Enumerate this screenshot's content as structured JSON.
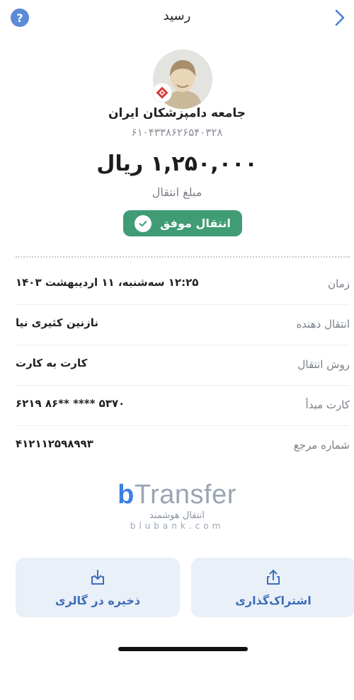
{
  "header": {
    "title": "رسید",
    "help_label": "?"
  },
  "recipient": {
    "name": "جامعه دامپزشکان ایران",
    "card_number": "۶۱۰۴۳۳۸۶۲۶۵۴۰۳۲۸"
  },
  "amount": {
    "value": "۱,۲۵۰,۰۰۰ ریال",
    "label": "مبلغ انتقال"
  },
  "status": {
    "text": "انتقال موفق"
  },
  "details": [
    {
      "label": "زمان",
      "value": "۱۲:۲۵ سه‌شنبه، ۱۱ اردیبهشت ۱۴۰۳"
    },
    {
      "label": "انتقال دهنده",
      "value": "نازنین کثیری نیا"
    },
    {
      "label": "روش انتقال",
      "value": "کارت به کارت"
    },
    {
      "label": "کارت مبدأ",
      "value": "۶۲۱۹ ۸۶** **** ۵۳۷۰"
    },
    {
      "label": "شماره مرجع",
      "value": "۴۱۲۱۱۲۵۹۸۹۹۳"
    }
  ],
  "brand": {
    "logo_b": "b",
    "logo_text": "Transfer",
    "tagline": "انتقال هوشمند",
    "domain": "blubank.com"
  },
  "actions": {
    "share_label": "اشتراک‌گذاری",
    "save_label": "ذخیره در گالری"
  },
  "colors": {
    "accent": "#3c7fe3",
    "success": "#3f9c74",
    "action_bg": "#e9f0f8"
  }
}
